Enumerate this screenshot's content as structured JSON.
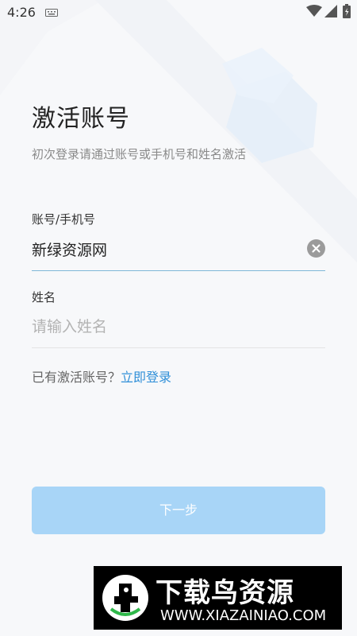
{
  "status_bar": {
    "time": "4:26",
    "icons": [
      "keyboard-icon",
      "wifi-icon",
      "signal-icon",
      "battery-icon"
    ]
  },
  "page": {
    "title": "激活账号",
    "subtitle": "初次登录请通过账号或手机号和姓名激活"
  },
  "form": {
    "account_label": "账号/手机号",
    "account_value": "新绿资源网",
    "name_label": "姓名",
    "name_value": "",
    "name_placeholder": "请输入姓名"
  },
  "login": {
    "prompt": "已有激活账号？",
    "link": "立即登录"
  },
  "next_button": "下一步",
  "watermark": {
    "title": "下载鸟资源",
    "url": "WWW.XIAZAINIAO.COM"
  },
  "colors": {
    "accent_link": "#2f8fd8",
    "button_disabled": "#a8d5f7",
    "active_underline": "#7fb8d8",
    "background": "#f7f8fa"
  }
}
